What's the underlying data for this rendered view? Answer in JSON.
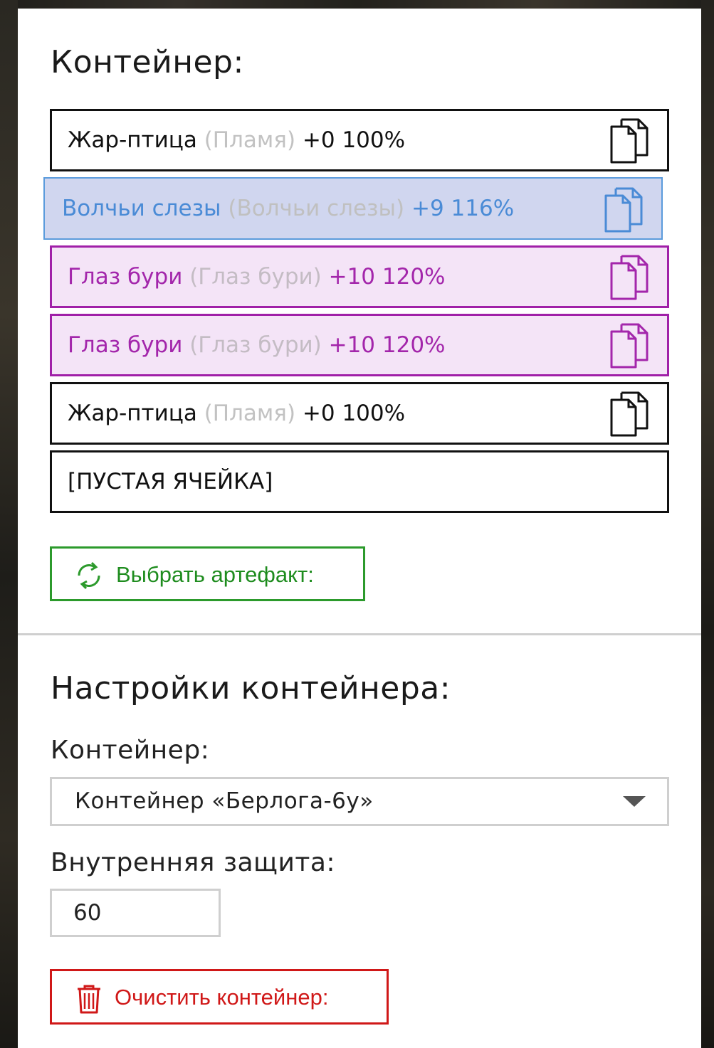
{
  "container": {
    "title": "Контейнер:",
    "slots": [
      {
        "name": "Жар-птица",
        "sub": "(Пламя)",
        "stats": "+0 100%",
        "style": "normal",
        "icon": "copy-icon"
      },
      {
        "name": "Волчьи слезы",
        "sub": "(Волчьи слезы)",
        "stats": "+9 116%",
        "style": "blue",
        "icon": "copy-icon"
      },
      {
        "name": "Глаз бури",
        "sub": "(Глаз бури)",
        "stats": "+10 120%",
        "style": "purple",
        "icon": "copy-icon"
      },
      {
        "name": "Глаз бури",
        "sub": "(Глаз бури)",
        "stats": "+10 120%",
        "style": "purple",
        "icon": "copy-icon"
      },
      {
        "name": "Жар-птица",
        "sub": "(Пламя)",
        "stats": "+0 100%",
        "style": "normal",
        "icon": "copy-icon"
      },
      {
        "name": "[ПУСТАЯ ЯЧЕЙКА]",
        "sub": "",
        "stats": "",
        "style": "empty",
        "icon": ""
      }
    ],
    "select_button": {
      "label": "Выбрать артефакт:",
      "icon": "refresh-icon"
    }
  },
  "settings": {
    "title": "Настройки контейнера:",
    "container_label": "Контейнер:",
    "container_value": "Контейнер «Берлога-6у»",
    "protection_label": "Внутренняя защита:",
    "protection_value": "60",
    "clear_button": {
      "label": "Очистить контейнер:",
      "icon": "trash-icon"
    }
  },
  "colors": {
    "select_green": "#1e8c1e",
    "clear_red": "#d01818",
    "blue_text": "#4a8bd6",
    "purple_text": "#a326ab"
  }
}
